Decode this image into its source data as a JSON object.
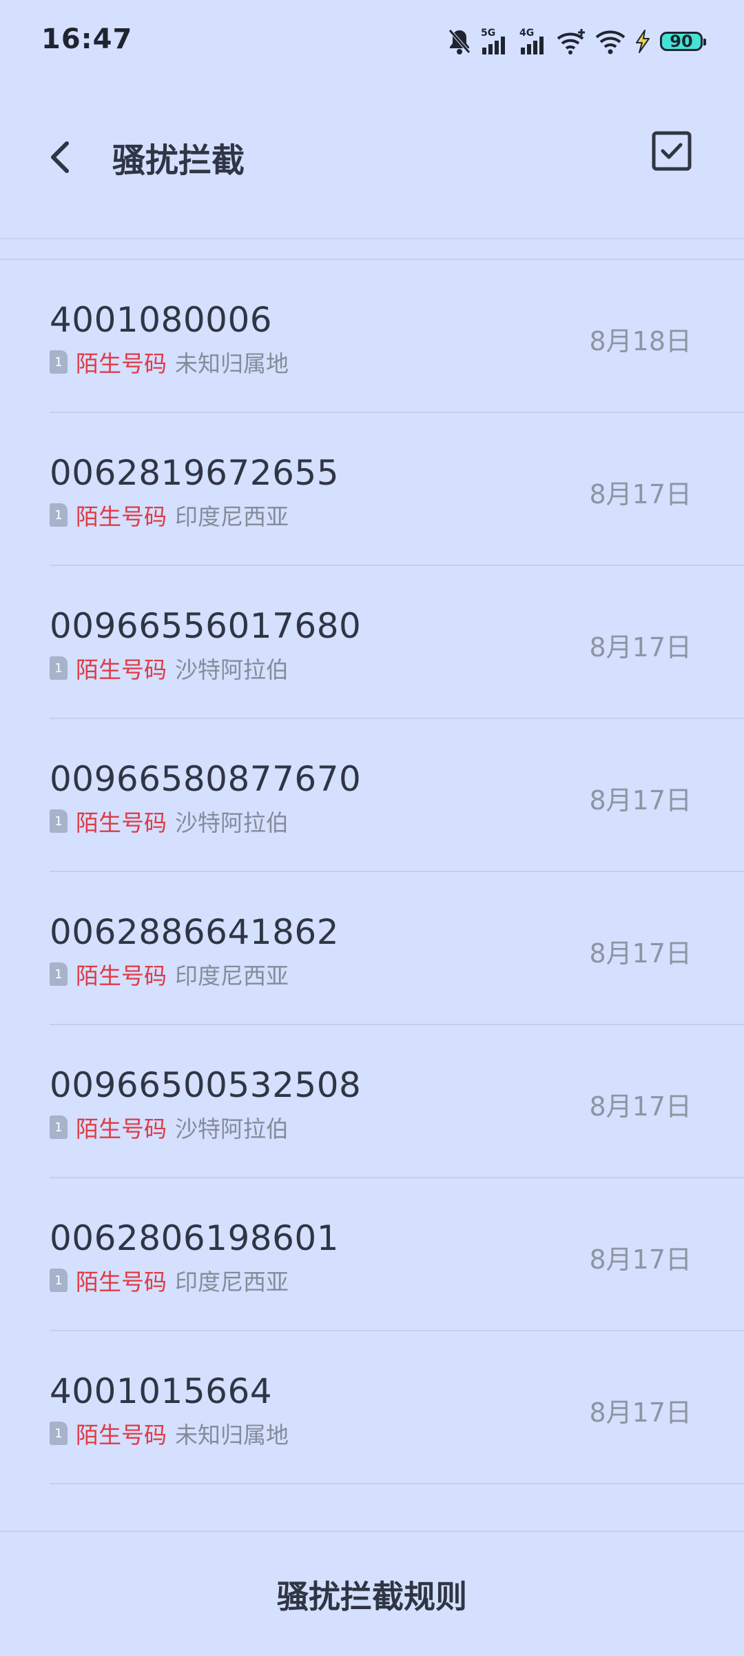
{
  "status_bar": {
    "time": "16:47",
    "network_1": "5G",
    "network_2": "4G",
    "battery": "90",
    "icons": [
      "mute-bell-icon",
      "signal-5g-icon",
      "signal-4g-icon",
      "wifi-calling-icon",
      "wifi-icon",
      "charging-icon",
      "battery-icon"
    ]
  },
  "header": {
    "title": "骚扰拦截",
    "back_icon": "chevron-left-icon",
    "select_icon": "checkbox-icon"
  },
  "calls": [
    {
      "number": "4001080006",
      "sim": "1",
      "tag": "陌生号码",
      "location": "未知归属地",
      "date": "8月18日"
    },
    {
      "number": "0062819672655",
      "sim": "1",
      "tag": "陌生号码",
      "location": "印度尼西亚",
      "date": "8月17日"
    },
    {
      "number": "00966556017680",
      "sim": "1",
      "tag": "陌生号码",
      "location": "沙特阿拉伯",
      "date": "8月17日"
    },
    {
      "number": "00966580877670",
      "sim": "1",
      "tag": "陌生号码",
      "location": "沙特阿拉伯",
      "date": "8月17日"
    },
    {
      "number": "0062886641862",
      "sim": "1",
      "tag": "陌生号码",
      "location": "印度尼西亚",
      "date": "8月17日"
    },
    {
      "number": "00966500532508",
      "sim": "1",
      "tag": "陌生号码",
      "location": "沙特阿拉伯",
      "date": "8月17日"
    },
    {
      "number": "0062806198601",
      "sim": "1",
      "tag": "陌生号码",
      "location": "印度尼西亚",
      "date": "8月17日"
    },
    {
      "number": "4001015664",
      "sim": "1",
      "tag": "陌生号码",
      "location": "未知归属地",
      "date": "8月17日"
    }
  ],
  "footer": {
    "rules_label": "骚扰拦截规则"
  },
  "colors": {
    "background": "#d4e0fe",
    "tag_red": "#e03a45",
    "text_primary": "#2f3544",
    "text_secondary": "#8e94a3"
  }
}
